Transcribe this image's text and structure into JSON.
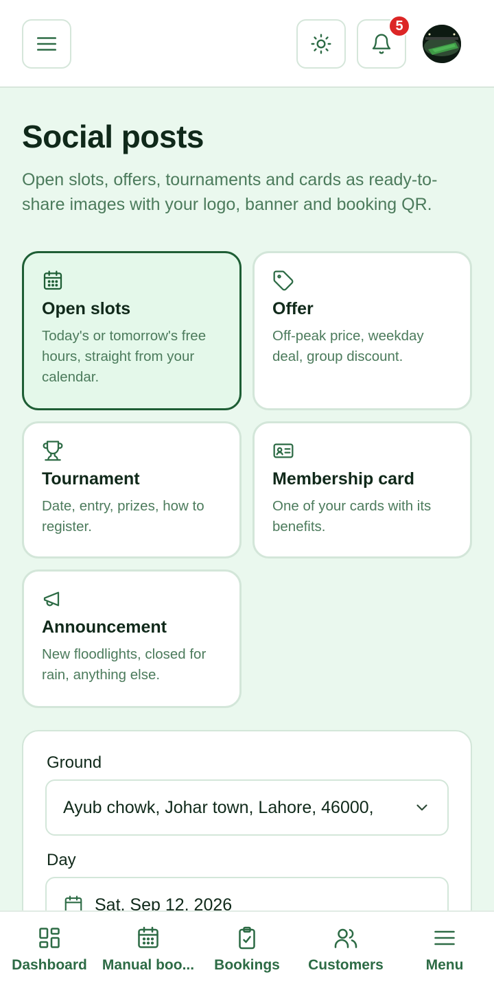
{
  "header": {
    "notification_count": "5"
  },
  "page": {
    "title": "Social posts",
    "subtitle": "Open slots, offers, tournaments and cards as ready-to-share images with your logo, banner and booking QR."
  },
  "post_types": [
    {
      "title": "Open slots",
      "description": "Today's or tomorrow's free hours, straight from your calendar.",
      "icon": "calendar-icon",
      "selected": true
    },
    {
      "title": "Offer",
      "description": "Off-peak price, weekday deal, group discount.",
      "icon": "tag-icon",
      "selected": false
    },
    {
      "title": "Tournament",
      "description": "Date, entry, prizes, how to register.",
      "icon": "trophy-icon",
      "selected": false
    },
    {
      "title": "Membership card",
      "description": "One of your cards with its benefits.",
      "icon": "id-card-icon",
      "selected": false
    },
    {
      "title": "Announcement",
      "description": "New floodlights, closed for rain, anything else.",
      "icon": "megaphone-icon",
      "selected": false
    }
  ],
  "form": {
    "ground_label": "Ground",
    "ground_value": "Ayub chowk, Johar town, Lahore, 46000,",
    "day_label": "Day",
    "day_value": "Sat, Sep 12, 2026"
  },
  "bottom_nav": [
    {
      "label": "Dashboard",
      "icon": "dashboard-icon"
    },
    {
      "label": "Manual boo...",
      "icon": "calendar-icon"
    },
    {
      "label": "Bookings",
      "icon": "clipboard-check-icon"
    },
    {
      "label": "Customers",
      "icon": "users-icon"
    },
    {
      "label": "Menu",
      "icon": "menu-icon"
    }
  ],
  "colors": {
    "accent": "#1e5e35",
    "page_bg": "#eaf8ee",
    "badge": "#dc2626"
  }
}
